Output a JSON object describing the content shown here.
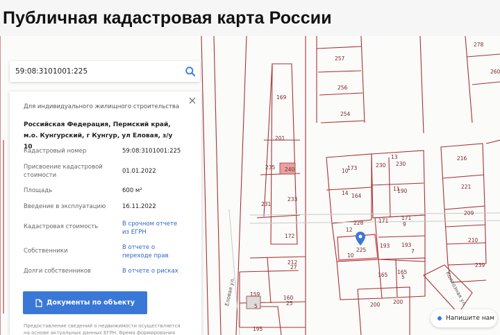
{
  "header": {
    "title": "Публичная кадастровая карта России"
  },
  "search": {
    "value": "59:08:3101001:225"
  },
  "panel": {
    "purpose": "Для индивидуального жилищного строительства",
    "address": "Российская Федерация, Пермский край, м.о. Кунгурский, г Кунгур, ул Еловая, з/у 10",
    "fields": {
      "cadastral_number_label": "Кадастровый номер",
      "cadastral_number_value": "59:08:3101001:225",
      "valuation_date_label": "Присвоение кадастровой стоимости",
      "valuation_date_value": "01.01.2022",
      "area_label": "Площадь",
      "area_value": "600 м²",
      "commissioning_label": "Введение в эксплуатацию",
      "commissioning_value": "16.11.2022",
      "cost_label": "Кадастровая стоимость",
      "cost_link": "В срочном отчете из ЕГРН",
      "owners_label": "Собственники",
      "owners_link": "В отчете о переходе прав",
      "debts_label": "Долги собственников",
      "debts_link": "В отчете о рисках"
    },
    "documents_button": "Документы по объекту",
    "disclaimer": "Предоставление сведений о недвижимости осуществляется на основе актуальных данных ЕГРН. Время формирования"
  },
  "map": {
    "parcels": [
      "278",
      "257",
      "260",
      "256",
      "254",
      "169",
      "201",
      "235",
      "240",
      "216",
      "173",
      "230",
      "230",
      "13",
      "10",
      "164",
      "190",
      "11",
      "221",
      "14",
      "231",
      "233",
      "228",
      "171",
      "171",
      "209",
      "12",
      "9",
      "172",
      "225",
      "10",
      "193",
      "193",
      "7",
      "210",
      "239",
      "212",
      "27",
      "165",
      "165",
      "5",
      "159",
      "5",
      "160",
      "25",
      "200",
      "200",
      "195"
    ],
    "streets": [
      "Еловая ул.",
      "Колхозная ул."
    ],
    "selected_parcel": "225"
  },
  "chat": {
    "label": "Напишите нам"
  },
  "colors": {
    "parcel_border": "#a83232",
    "accent": "#3a78d8",
    "selected": "#d9505a"
  }
}
